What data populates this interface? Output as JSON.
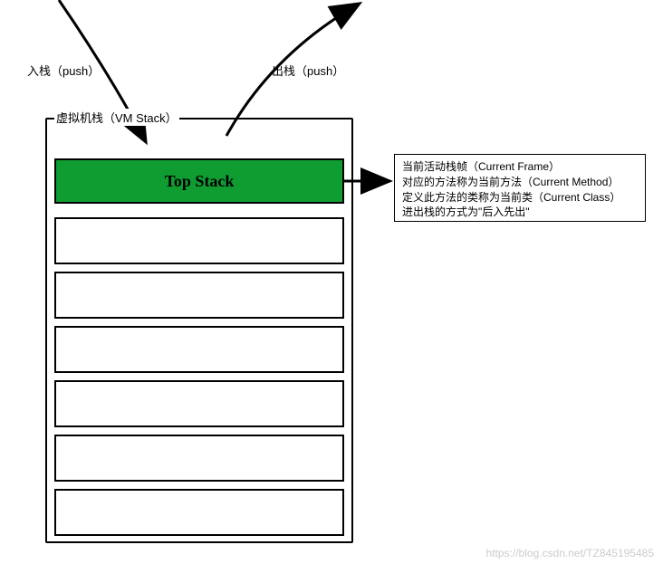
{
  "labels": {
    "pushIn": "入栈（push）",
    "pushOut": "出栈（push）",
    "vmStack": "虚拟机栈（VM Stack）",
    "topStack": "Top Stack"
  },
  "infoBox": {
    "line1": "当前活动栈帧（Current Frame）",
    "line2": "对应的方法称为当前方法（Current Method）",
    "line3": "定义此方法的类称为当前类（Current Class）",
    "line4": "进出栈的方式为\"后入先出\""
  },
  "watermark": "https://blog.csdn.net/TZ845195485"
}
